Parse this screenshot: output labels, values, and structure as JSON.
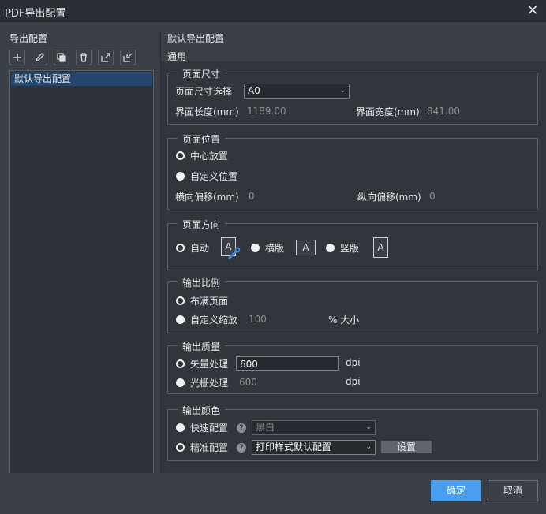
{
  "window": {
    "title": "PDF导出配置",
    "close_icon": "close-icon"
  },
  "left": {
    "title": "导出配置",
    "toolbar": [
      "add-icon",
      "edit-icon",
      "copy-icon",
      "delete-icon",
      "export-icon",
      "import-icon"
    ],
    "items": [
      "默认导出配置"
    ]
  },
  "right": {
    "title": "默认导出配置",
    "tab": "通用",
    "page_size": {
      "legend": "页面尺寸",
      "select_label": "页面尺寸选择",
      "select_value": "A0",
      "length_label": "界面长度(mm)",
      "length_value": "1189.00",
      "width_label": "界面宽度(mm)",
      "width_value": "841.00"
    },
    "page_position": {
      "legend": "页面位置",
      "center": "中心放置",
      "custom": "自定义位置",
      "h_offset_label": "横向偏移(mm)",
      "h_offset_value": "0",
      "v_offset_label": "纵向偏移(mm)",
      "v_offset_value": "0"
    },
    "orientation": {
      "legend": "页面方向",
      "auto": "自动",
      "landscape": "横版",
      "portrait": "竖版",
      "icon_letter": "A"
    },
    "scale": {
      "legend": "输出比例",
      "fill": "布满页面",
      "custom": "自定义缩放",
      "custom_value": "100",
      "unit": "% 大小"
    },
    "quality": {
      "legend": "输出质量",
      "vector": "矢量处理",
      "vector_value": "600",
      "raster": "光栅处理",
      "raster_value": "600",
      "unit": "dpi"
    },
    "color": {
      "legend": "输出颜色",
      "quick": "快速配置",
      "quick_value": "黑白",
      "precise": "精准配置",
      "precise_value": "打印样式默认配置",
      "settings": "设置",
      "help": "?"
    }
  },
  "footer": {
    "ok": "确定",
    "cancel": "取消"
  },
  "colors": {
    "accent": "#4a9ef0",
    "selection": "#23466f"
  }
}
